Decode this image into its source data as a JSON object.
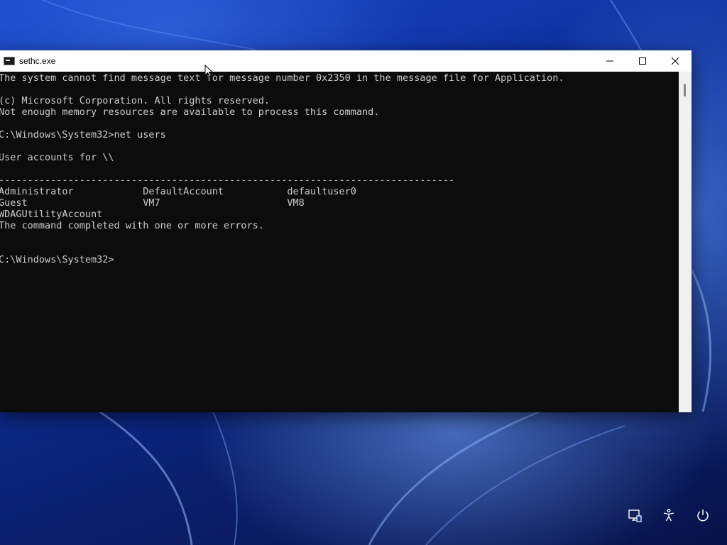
{
  "window": {
    "title": "sethc.exe",
    "icon": "console-app-icon",
    "controls": {
      "minimize": "minimize-icon",
      "maximize": "maximize-icon",
      "close": "close-icon"
    }
  },
  "console": {
    "lines": [
      "The system cannot find message text for message number 0x2350 in the message file for Application.",
      "",
      "(c) Microsoft Corporation. All rights reserved.",
      "Not enough memory resources are available to process this command.",
      "",
      "C:\\Windows\\System32>net users",
      "",
      "User accounts for \\\\",
      "",
      "-------------------------------------------------------------------------------",
      "Administrator            DefaultAccount           defaultuser0",
      "Guest                    VM7                      VM8",
      "WDAGUtilityAccount",
      "The command completed with one or more errors.",
      "",
      "",
      "C:\\Windows\\System32>"
    ]
  },
  "tray": {
    "network": "network-icon",
    "accessibility": "accessibility-icon",
    "power": "power-icon"
  }
}
